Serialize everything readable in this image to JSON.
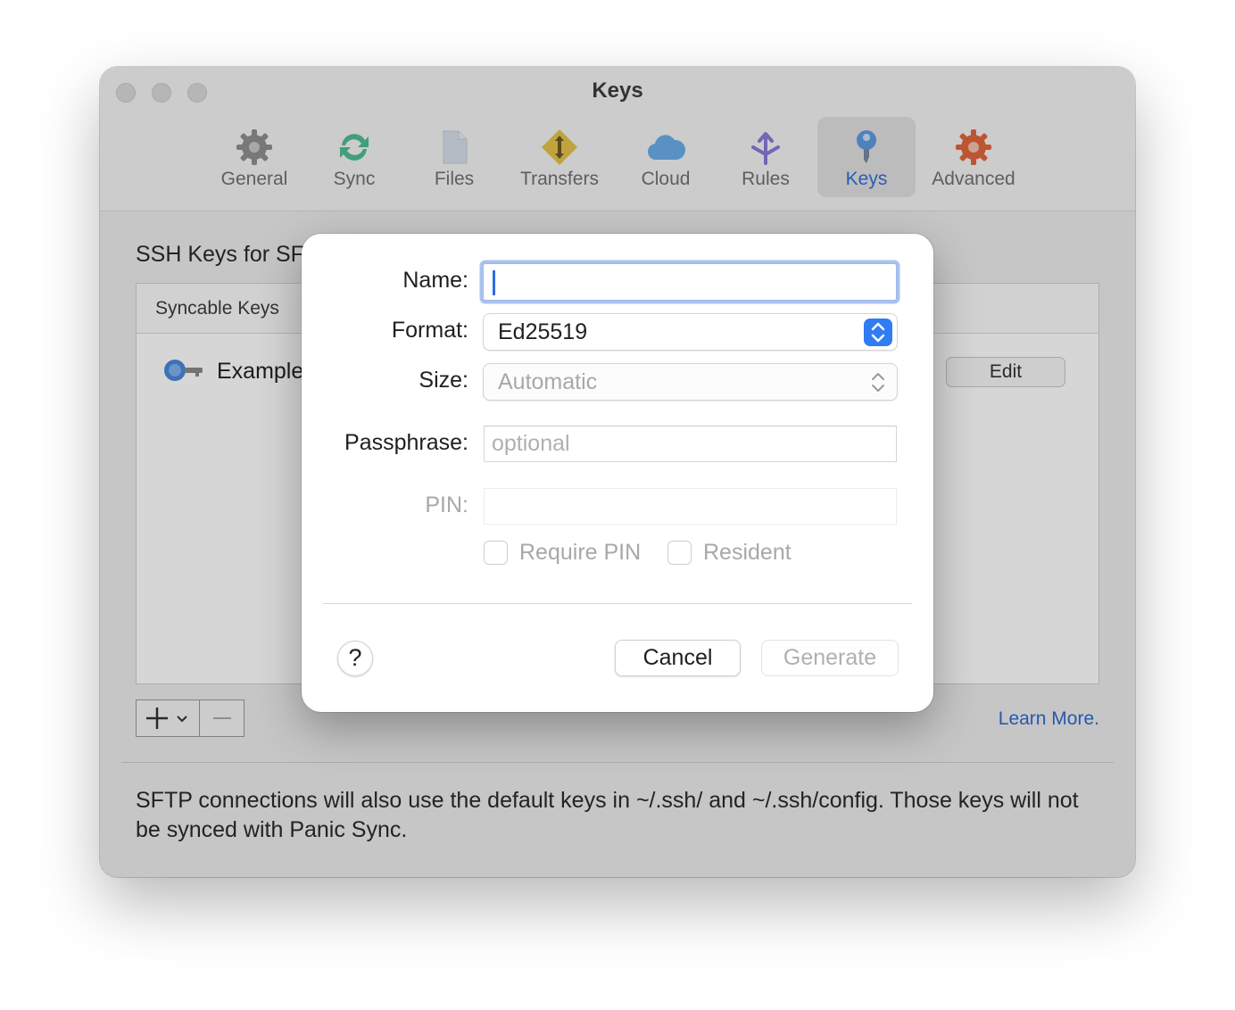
{
  "window": {
    "title": "Keys",
    "tabs": [
      {
        "label": "General",
        "icon": "gear-icon",
        "color": "#8f8f8f"
      },
      {
        "label": "Sync",
        "icon": "sync-icon",
        "color": "#4fbe93"
      },
      {
        "label": "Files",
        "icon": "file-icon",
        "color": "#c9d5e6"
      },
      {
        "label": "Transfers",
        "icon": "transfer-icon",
        "color": "#e6b72e"
      },
      {
        "label": "Cloud",
        "icon": "cloud-icon",
        "color": "#5aa3e6"
      },
      {
        "label": "Rules",
        "icon": "rules-icon",
        "color": "#8b7ad8"
      },
      {
        "label": "Keys",
        "icon": "key-icon",
        "color": "#3b82d6"
      },
      {
        "label": "Advanced",
        "icon": "advanced-gear-icon",
        "color": "#e3663c"
      }
    ],
    "active_tab": "Keys"
  },
  "main": {
    "section_title": "SSH Keys for SF",
    "table_header": "Syncable Keys",
    "rows": [
      {
        "label": "Example",
        "icon": "key-icon"
      }
    ],
    "edit_label": "Edit",
    "learn_more": "Learn More.",
    "footer_note": "SFTP connections will also use the default keys in ~/.ssh/ and ~/.ssh/config. Those keys will not be synced with Panic Sync."
  },
  "sheet": {
    "name_label": "Name:",
    "name_value": "",
    "format_label": "Format:",
    "format_value": "Ed25519",
    "size_label": "Size:",
    "size_value": "Automatic",
    "passphrase_label": "Passphrase:",
    "passphrase_placeholder": "optional",
    "pin_label": "PIN:",
    "require_pin_label": "Require PIN",
    "resident_label": "Resident",
    "help_label": "?",
    "cancel_label": "Cancel",
    "generate_label": "Generate",
    "accent_color": "#2f7cf3"
  }
}
